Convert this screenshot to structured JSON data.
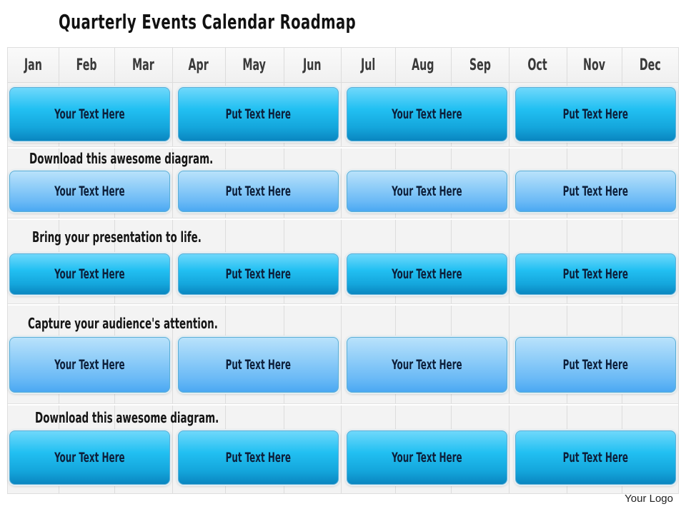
{
  "title": "Quarterly Events Calendar Roadmap",
  "months": [
    "Jan",
    "Feb",
    "Mar",
    "Apr",
    "May",
    "Jun",
    "Jul",
    "Aug",
    "Sep",
    "Oct",
    "Nov",
    "Dec"
  ],
  "rows": [
    {
      "caption": "",
      "style": "dark",
      "boxes": [
        "Your Text Here",
        "Put Text Here",
        "Your Text Here",
        "Put Text Here"
      ]
    },
    {
      "caption": "Download this awesome diagram.",
      "style": "light",
      "boxes": [
        "Your Text Here",
        "Put Text Here",
        "Your Text Here",
        "Put Text Here"
      ]
    },
    {
      "caption": "Bring your presentation to life.",
      "style": "dark",
      "boxes": [
        "Your Text Here",
        "Put Text Here",
        "Your Text Here",
        "Put Text Here"
      ]
    },
    {
      "caption": "Capture your audience's attention.",
      "style": "light",
      "boxes": [
        "Your Text Here",
        "Put Text Here",
        "Your Text Here",
        "Put Text Here"
      ]
    },
    {
      "caption": "Download this awesome diagram.",
      "style": "dark",
      "boxes": [
        "Your Text Here",
        "Put Text Here",
        "Your Text Here",
        "Put Text Here"
      ]
    }
  ],
  "logo": "Your Logo",
  "colors": {
    "box_dark_top": "#6fd8fb",
    "box_dark_bottom": "#0a86c0",
    "box_light_top": "#b9e2fb",
    "box_light_bottom": "#4aa8f2",
    "box_text": "#0d1f3a"
  }
}
